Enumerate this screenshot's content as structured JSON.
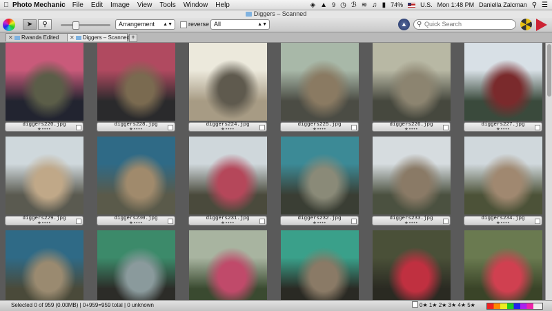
{
  "menubar": {
    "app_name": "Photo Mechanic",
    "items": [
      "File",
      "Edit",
      "Image",
      "View",
      "Tools",
      "Window",
      "Help"
    ],
    "adobe_count": "9",
    "battery": "74%",
    "input_source": "U.S.",
    "clock": "Mon 1:48 PM",
    "user": "Daniella Zalcman"
  },
  "window": {
    "title": "Diggers – Scanned"
  },
  "toolbar": {
    "sort_value": "Arrangement",
    "reverse_label": "reverse",
    "filter_value": "All",
    "search_placeholder": "Quick Search"
  },
  "tabs": [
    {
      "label": "Rwanda Edited"
    },
    {
      "label": "Diggers – Scanned"
    }
  ],
  "thumbnails": [
    {
      "file": "diggers220.jpg",
      "rating": "★••••",
      "palette": [
        "#c95a7a",
        "#222430",
        "#5b5d48"
      ]
    },
    {
      "file": "diggers228.jpg",
      "rating": "★••••",
      "palette": [
        "#b04a60",
        "#2a2a2c",
        "#7a6a50"
      ]
    },
    {
      "file": "diggers224.jpg",
      "rating": "★••••",
      "palette": [
        "#ece9dc",
        "#a79b84",
        "#5f5a4e"
      ]
    },
    {
      "file": "diggers225.jpg",
      "rating": "★••••",
      "palette": [
        "#a8b8a8",
        "#4b4c44",
        "#8a7a62"
      ]
    },
    {
      "file": "diggers226.jpg",
      "rating": "★••••",
      "palette": [
        "#b8b8a4",
        "#46483e",
        "#8c8470"
      ]
    },
    {
      "file": "diggers227.jpg",
      "rating": "★••••",
      "palette": [
        "#d8e0e6",
        "#3a4a3c",
        "#7a2a2c"
      ]
    },
    {
      "file": "diggers229.jpg",
      "rating": "★••••",
      "palette": [
        "#cfd8dc",
        "#5a5a50",
        "#c0a888"
      ]
    },
    {
      "file": "diggers230.jpg",
      "rating": "★••••",
      "palette": [
        "#2f6a86",
        "#5a5a4a",
        "#a08a6c"
      ]
    },
    {
      "file": "diggers231.jpg",
      "rating": "★••••",
      "palette": [
        "#cfd7db",
        "#4a4a3c",
        "#b5475a"
      ]
    },
    {
      "file": "diggers232.jpg",
      "rating": "★••••",
      "palette": [
        "#3c8a96",
        "#3a3e34",
        "#8a8a78"
      ]
    },
    {
      "file": "diggers233.jpg",
      "rating": "★••••",
      "palette": [
        "#d6dcdf",
        "#4b5140",
        "#8a7a66"
      ]
    },
    {
      "file": "diggers234.jpg",
      "rating": "★••••",
      "palette": [
        "#d0d8dc",
        "#4c5238",
        "#a08870"
      ]
    },
    {
      "file": "",
      "rating": "",
      "palette": [
        "#2f6a86",
        "#4a4a3a",
        "#9a8a70"
      ]
    },
    {
      "file": "",
      "rating": "",
      "palette": [
        "#3c8a6a",
        "#2c2c28",
        "#8a9a9c"
      ]
    },
    {
      "file": "",
      "rating": "",
      "palette": [
        "#a8b4a0",
        "#3a4a30",
        "#c04a6a"
      ]
    },
    {
      "file": "",
      "rating": "",
      "palette": [
        "#3aa08a",
        "#2a2a24",
        "#8a7a66"
      ]
    },
    {
      "file": "",
      "rating": "",
      "palette": [
        "#4a5038",
        "#2a2a22",
        "#c03040"
      ]
    },
    {
      "file": "",
      "rating": "",
      "palette": [
        "#6a7a50",
        "#3a4428",
        "#d04050"
      ]
    }
  ],
  "statusbar": {
    "info": "Selected 0 of 959 (0.00MB) | 0+959=959 total | 0 unknown",
    "rating_filter": "0★ 1★ 2★ 3★ 4★ 5★"
  }
}
